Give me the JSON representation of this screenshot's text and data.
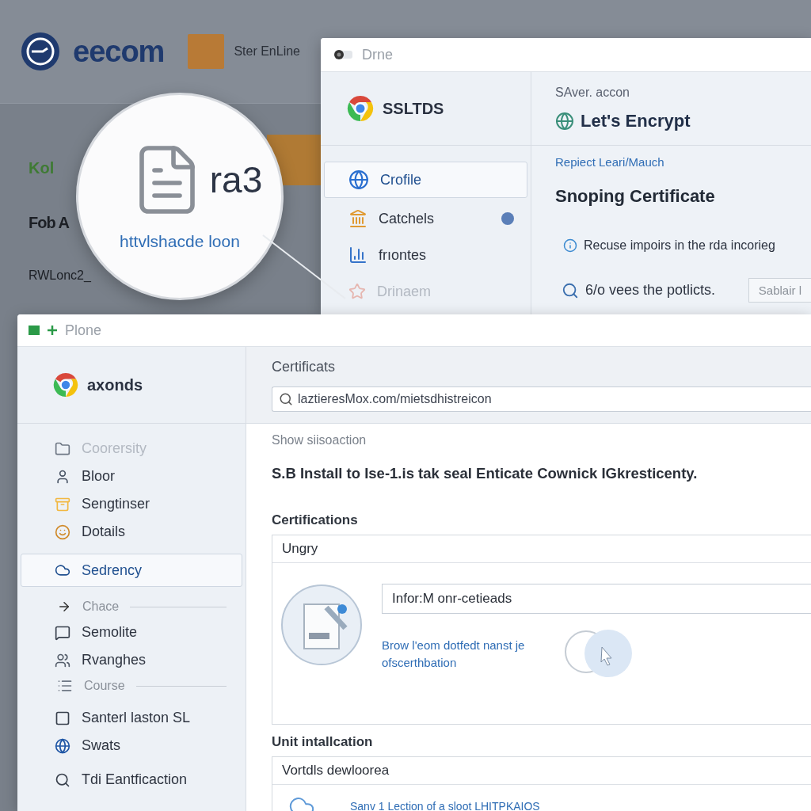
{
  "background": {
    "logo": "eecom",
    "site_name": "Ster EnLine",
    "texts": [
      "Kol",
      "Fob A",
      "RWLonc2_"
    ]
  },
  "magnifier": {
    "title": "ra3",
    "link": "httvlshacde loon"
  },
  "back_window": {
    "title": "Drne",
    "brand": "SSLTDS",
    "items": [
      {
        "label": "Crofile",
        "selected": true,
        "disabled": false,
        "badge": false
      },
      {
        "label": "Catchels",
        "selected": false,
        "disabled": false,
        "badge": true
      },
      {
        "label": "frıontes",
        "selected": false,
        "disabled": false,
        "badge": false
      },
      {
        "label": "Drinaem",
        "selected": false,
        "disabled": true,
        "badge": false
      }
    ],
    "eyebrow": "SAver. accon",
    "provider": "Let's Encrypt",
    "link": "Repiect Leari/Mauch",
    "heading": "Snoping Certificate",
    "info": "Recuse impoirs in the rda incorieg",
    "search_text": "6/o vees the potlicts.",
    "button": "Sablair l"
  },
  "front_window": {
    "title": "Plone",
    "brand": "axonds",
    "items": [
      {
        "kind": "item",
        "label": "Coorersity",
        "selected": false,
        "disabled": true
      },
      {
        "kind": "item",
        "label": "Bloor",
        "selected": false,
        "disabled": false
      },
      {
        "kind": "item",
        "label": "Sengtinser",
        "selected": false,
        "disabled": false
      },
      {
        "kind": "item",
        "label": "Dotails",
        "selected": false,
        "disabled": false
      },
      {
        "kind": "item",
        "label": "Sedrency",
        "selected": true,
        "disabled": false
      },
      {
        "kind": "section",
        "label": "Chace",
        "selected": false,
        "disabled": false
      },
      {
        "kind": "item",
        "label": "Semolite",
        "selected": false,
        "disabled": false
      },
      {
        "kind": "item",
        "label": "Rvanghes",
        "selected": false,
        "disabled": false
      },
      {
        "kind": "section",
        "label": "Course",
        "selected": false,
        "disabled": false
      },
      {
        "kind": "item",
        "label": "Santerl laston SL",
        "selected": false,
        "disabled": false
      },
      {
        "kind": "item",
        "label": "Swats",
        "selected": false,
        "disabled": false
      },
      {
        "kind": "item",
        "label": "Tdi Eantficaction",
        "selected": false,
        "disabled": false
      }
    ],
    "page_title": "Certificats",
    "address": "laztieresMox.com/mietsdhistreicon",
    "subtitle": "Show siisoaction",
    "sentence": "S.B Install to Ise-1.is tak seal Enticate Cownick IGkresticenty.",
    "sections": [
      {
        "heading": "Certifications",
        "card_title": "Ungry",
        "field": "Infor:M onr-cetieads",
        "link": "Brow l'eom dotfedt nanst je ofscerthbation"
      },
      {
        "heading": "Unit intallcation",
        "card_title": "Vortdls dewloorea",
        "line": "Sanv 1 Lection of a sloot LHITPKAIOS"
      }
    ]
  }
}
